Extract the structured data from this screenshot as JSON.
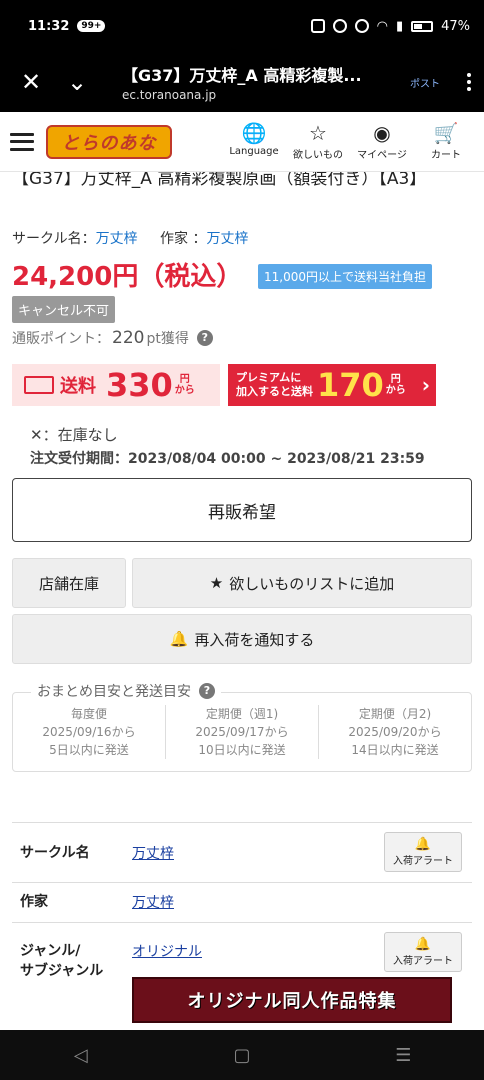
{
  "status": {
    "time": "11:32",
    "badge": "99+",
    "battery": "47%"
  },
  "tabbar": {
    "title": "【G37】万丈梓_A 高精彩複製...",
    "url": "ec.toranoana.jp",
    "post_label": "ポスト"
  },
  "header": {
    "logo_text": "とらのあな",
    "nav": [
      {
        "label": "Language",
        "icon": "globe-icon"
      },
      {
        "label": "欲しいもの",
        "icon": "star-icon"
      },
      {
        "label": "マイページ",
        "icon": "user-icon"
      },
      {
        "label": "カート",
        "icon": "cart-icon"
      }
    ]
  },
  "product": {
    "title": "【G37】万丈梓_A 高精彩複製原画（額装付き）【A3】",
    "circle_label": "サークル名：",
    "circle": "万丈梓",
    "author_label": "作家 ：",
    "author": "万丈梓",
    "price": "24,200円（税込）",
    "ship_note": "11,000円以上で送料当社負担",
    "cancel_badge": "キャンセル不可",
    "points_label": "通販ポイント：",
    "points_value": "220",
    "points_unit": "pt獲得",
    "shipping_label": "送料",
    "shipping_amount": "330",
    "shipping_unit_top": "円",
    "shipping_unit_bottom": "から",
    "premium_line1": "プレミアムに",
    "premium_line2": "加入すると送料",
    "premium_amount": "170",
    "premium_unit_top": "円",
    "premium_unit_bottom": "から",
    "stock": "✕：在庫なし",
    "period": "注文受付期間：2023/08/04 00:00 ~ 2023/08/21 23:59"
  },
  "buttons": {
    "resale": "再販希望",
    "store_stock": "店舗在庫",
    "wishlist": "欲しいものリストに追加",
    "notify": "再入荷を通知する"
  },
  "delivery": {
    "heading": "おまとめ目安と発送目安",
    "columns": [
      {
        "type": "毎度便",
        "date": "2025/09/16から",
        "ship": "5日以内に発送"
      },
      {
        "type": "定期便（週1)",
        "date": "2025/09/17から",
        "ship": "10日以内に発送"
      },
      {
        "type": "定期便（月2)",
        "date": "2025/09/20から",
        "ship": "14日以内に発送"
      }
    ]
  },
  "specs": {
    "rows": [
      {
        "key": "サークル名",
        "value": "万丈梓",
        "alert": "入荷アラート"
      },
      {
        "key": "作家",
        "value": "万丈梓"
      },
      {
        "key_line1": "ジャンル/",
        "key_line2": "サブジャンル",
        "value": "オリジナル",
        "alert": "入荷アラート"
      }
    ],
    "banner": "オリジナル同人作品特集"
  }
}
